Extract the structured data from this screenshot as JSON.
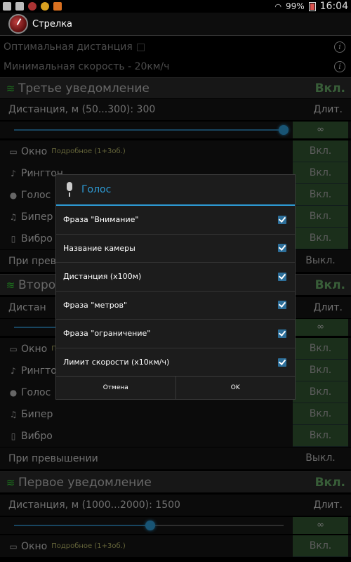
{
  "status": {
    "battery": "99%",
    "time": "16:04"
  },
  "app": {
    "title": "Стрелка"
  },
  "settings": {
    "optimal_distance": "Оптимальная дистанция",
    "min_speed": "Минимальная скорость - 20км/ч"
  },
  "section3": {
    "title": "Третье уведомление",
    "state": "Вкл.",
    "distance": "Дистанция, м (50...300): 300",
    "duration_label": "Длит.",
    "infinity": "∞",
    "slider_value": 300,
    "slider_min": 50,
    "slider_max": 300,
    "window_label": "Окно",
    "window_detail": "Подробное (1+3об.)",
    "window_state": "Вкл.",
    "ringtone_label": "Рингтон",
    "ringtone_state": "Вкл.",
    "voice_label": "Голос",
    "voice_state": "Вкл.",
    "beeper_label": "Бипер",
    "beeper_state": "Вкл.",
    "vibro_label": "Вибро",
    "vibro_state": "Вкл.",
    "exceed_label": "При превыш",
    "exceed_state": "Выкл."
  },
  "section2": {
    "title": "Второе",
    "state": "Вкл.",
    "distance": "Дистан",
    "duration_label": "Длит.",
    "infinity": "∞",
    "window_label": "Окно",
    "window_detail": "П",
    "window_state": "Вкл.",
    "ringtone_label": "Рингтон",
    "ringtone_state": "Вкл.",
    "voice_label": "Голос",
    "voice_state": "Вкл.",
    "beeper_label": "Бипер",
    "beeper_state": "Вкл.",
    "vibro_label": "Вибро",
    "vibro_state": "Вкл.",
    "exceed_label": "При превышении",
    "exceed_state": "Выкл."
  },
  "section1": {
    "title": "Первое уведомление",
    "state": "Вкл.",
    "distance": "Дистанция, м (1000...2000): 1500",
    "duration_label": "Длит.",
    "infinity": "∞",
    "slider_value": 1500,
    "slider_min": 1000,
    "slider_max": 2000,
    "window_label": "Окно",
    "window_detail": "Подробное (1+3об.)",
    "window_state": "Вкл."
  },
  "dialog": {
    "title": "Голос",
    "items": [
      {
        "label": "Фраза \"Внимание\"",
        "checked": true
      },
      {
        "label": "Название камеры",
        "checked": true
      },
      {
        "label": "Дистанция (х100м)",
        "checked": true
      },
      {
        "label": "Фраза \"метров\"",
        "checked": true
      },
      {
        "label": "Фраза \"ограничение\"",
        "checked": true
      },
      {
        "label": "Лимит скорости (х10км/ч)",
        "checked": true
      }
    ],
    "cancel": "Отмена",
    "ok": "OK"
  },
  "colors": {
    "accent": "#2d9ad4",
    "green_on": "#66aa66",
    "button_green": "#325632"
  }
}
